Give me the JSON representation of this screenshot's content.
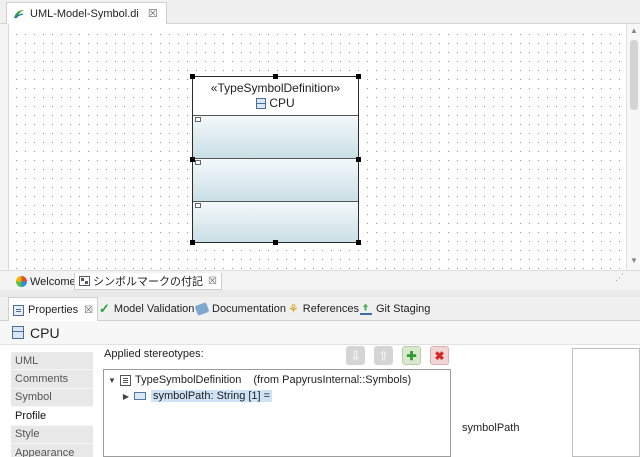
{
  "editor": {
    "tab_title": "UML-Model-Symbol.di",
    "close_glyph": "☒"
  },
  "diagram": {
    "class": {
      "stereotype": "«TypeSymbolDefinition»",
      "name": "CPU",
      "compartments": 3
    }
  },
  "page_tabs": [
    {
      "label": "Welcome",
      "icon": "welcome-icon"
    },
    {
      "label": "シンボルマークの付記",
      "icon": "diagram-icon",
      "close": "☒"
    }
  ],
  "view_tabs": [
    {
      "label": "Properties",
      "icon": "properties-icon",
      "close": "☒"
    },
    {
      "label": "Model Validation",
      "icon": "check-icon"
    },
    {
      "label": "Documentation",
      "icon": "documentation-icon"
    },
    {
      "label": "References",
      "icon": "references-icon"
    },
    {
      "label": "Git Staging",
      "icon": "git-staging-icon"
    }
  ],
  "properties": {
    "element_title": "CPU",
    "sections": [
      "UML",
      "Comments",
      "Symbol",
      "Profile",
      "Style",
      "Appearance"
    ],
    "active_section": "Profile",
    "applied_stereotypes_label": "Applied stereotypes:",
    "toolbar": {
      "add_glyph": "✚",
      "delete_glyph": "✖",
      "up_glyph": "⇧",
      "down_glyph": "⇩"
    },
    "tree": {
      "stereotype_name": "TypeSymbolDefinition",
      "stereotype_source": "(from PapyrusInternal::Symbols)",
      "property": "symbolPath: String [1] ="
    },
    "symbol_path_label": "symbolPath"
  }
}
